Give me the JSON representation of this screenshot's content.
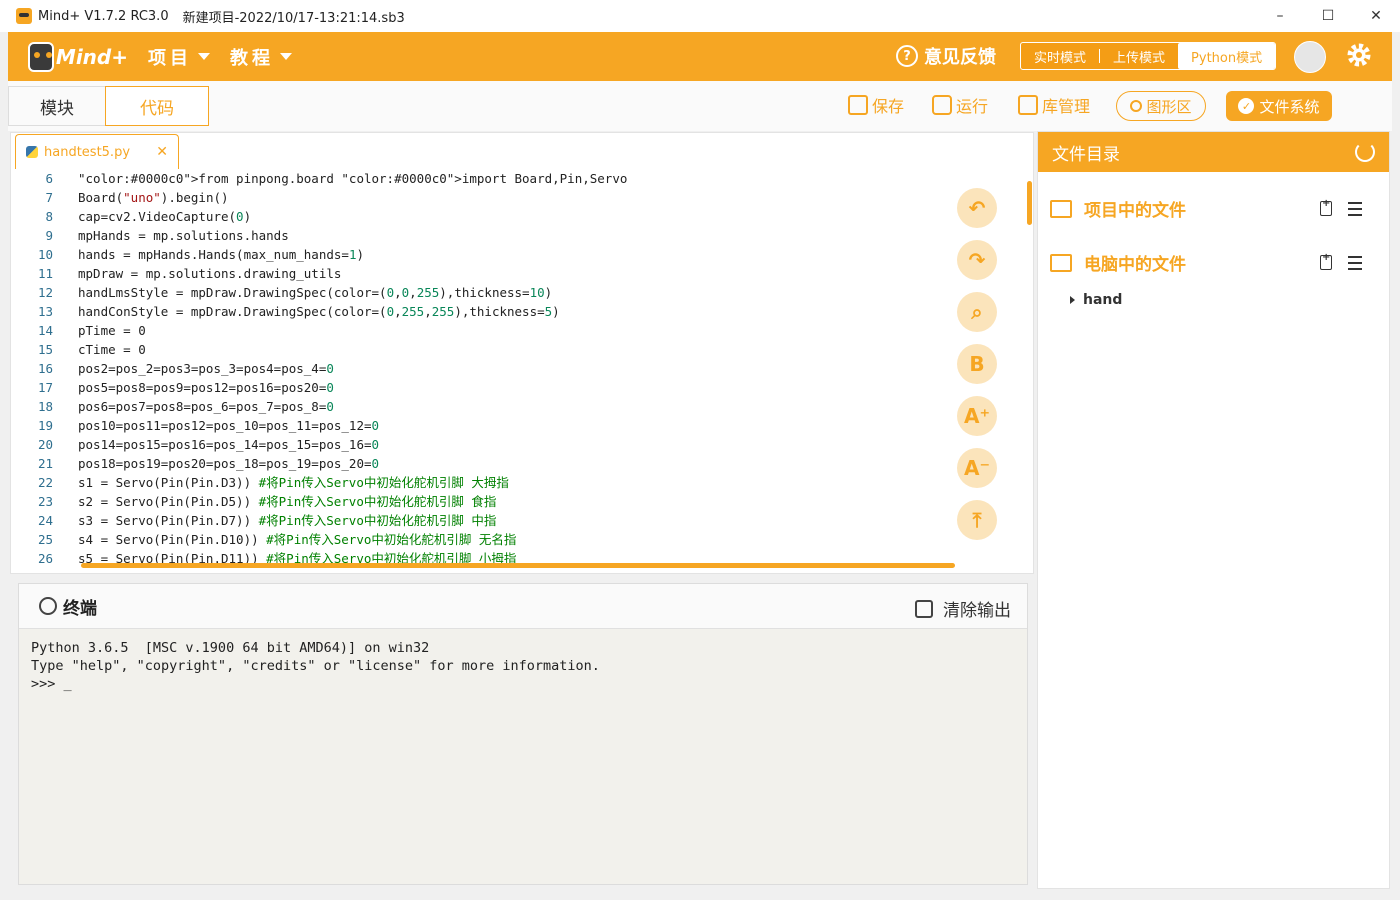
{
  "window": {
    "app_name": "Mind+ V1.7.2 RC3.0",
    "project": "新建项目-2022/10/17-13:21:14.sb3",
    "minimize": "–",
    "maximize": "☐",
    "close": "✕"
  },
  "topbar": {
    "logo_text": "Mind+",
    "menu_project": "项目",
    "menu_tutorial": "教程",
    "feedback": "意见反馈",
    "modes": [
      "实时模式",
      "上传模式",
      "Python模式"
    ],
    "active_mode": "Python模式"
  },
  "toolbar": {
    "tab_blocks": "模块",
    "tab_code": "代码",
    "save": "保存",
    "run": "运行",
    "library": "库管理",
    "graph": "图形区",
    "file_system": "文件系统"
  },
  "editor": {
    "file_tab": "handtest5.py",
    "lines": [
      {
        "n": "6",
        "code": "from pinpong.board import Board,Pin,Servo"
      },
      {
        "n": "7",
        "code": "Board(\"uno\").begin()"
      },
      {
        "n": "8",
        "code": "cap=cv2.VideoCapture(0)"
      },
      {
        "n": "9",
        "code": "mpHands = mp.solutions.hands"
      },
      {
        "n": "10",
        "code": "hands = mpHands.Hands(max_num_hands=1)"
      },
      {
        "n": "11",
        "code": "mpDraw = mp.solutions.drawing_utils"
      },
      {
        "n": "12",
        "code": "handLmsStyle = mpDraw.DrawingSpec(color=(0,0,255),thickness=10)"
      },
      {
        "n": "13",
        "code": "handConStyle = mpDraw.DrawingSpec(color=(0,255,255),thickness=5)"
      },
      {
        "n": "14",
        "code": "pTime = 0"
      },
      {
        "n": "15",
        "code": "cTime = 0"
      },
      {
        "n": "16",
        "code": "pos2=pos_2=pos3=pos_3=pos4=pos_4=0"
      },
      {
        "n": "17",
        "code": "pos5=pos8=pos9=pos12=pos16=pos20=0"
      },
      {
        "n": "18",
        "code": "pos6=pos7=pos8=pos_6=pos_7=pos_8=0"
      },
      {
        "n": "19",
        "code": "pos10=pos11=pos12=pos_10=pos_11=pos_12=0"
      },
      {
        "n": "20",
        "code": "pos14=pos15=pos16=pos_14=pos_15=pos_16=0"
      },
      {
        "n": "21",
        "code": "pos18=pos19=pos20=pos_18=pos_19=pos_20=0"
      },
      {
        "n": "22",
        "code": "s1 = Servo(Pin(Pin.D3)) #将Pin传入Servo中初始化舵机引脚 大拇指"
      },
      {
        "n": "23",
        "code": "s2 = Servo(Pin(Pin.D5)) #将Pin传入Servo中初始化舵机引脚 食指"
      },
      {
        "n": "24",
        "code": "s3 = Servo(Pin(Pin.D7)) #将Pin传入Servo中初始化舵机引脚 中指"
      },
      {
        "n": "25",
        "code": "s4 = Servo(Pin(Pin.D10)) #将Pin传入Servo中初始化舵机引脚 无名指"
      },
      {
        "n": "26",
        "code": "s5 = Servo(Pin(Pin.D11)) #将Pin传入Servo中初始化舵机引脚 小拇指"
      }
    ],
    "side_buttons": [
      {
        "name": "undo-button",
        "glyph": "↶"
      },
      {
        "name": "redo-button",
        "glyph": "↷"
      },
      {
        "name": "search-button",
        "glyph": "⌕"
      },
      {
        "name": "format-button",
        "glyph": "B"
      },
      {
        "name": "font-increase-button",
        "glyph": "A⁺"
      },
      {
        "name": "font-decrease-button",
        "glyph": "A⁻"
      },
      {
        "name": "scroll-top-button",
        "glyph": "⤒"
      }
    ]
  },
  "terminal": {
    "title": "终端",
    "clear": "清除输出",
    "output": "Python 3.6.5  [MSC v.1900 64 bit AMD64)] on win32\nType \"help\", \"copyright\", \"credits\" or \"license\" for more information.\n>>> _"
  },
  "files": {
    "title": "文件目录",
    "project_files": "项目中的文件",
    "computer_files": "电脑中的文件",
    "tree": [
      "hand"
    ]
  },
  "colors": {
    "accent": "#f6a623",
    "code_number": "#2f6f8f"
  }
}
